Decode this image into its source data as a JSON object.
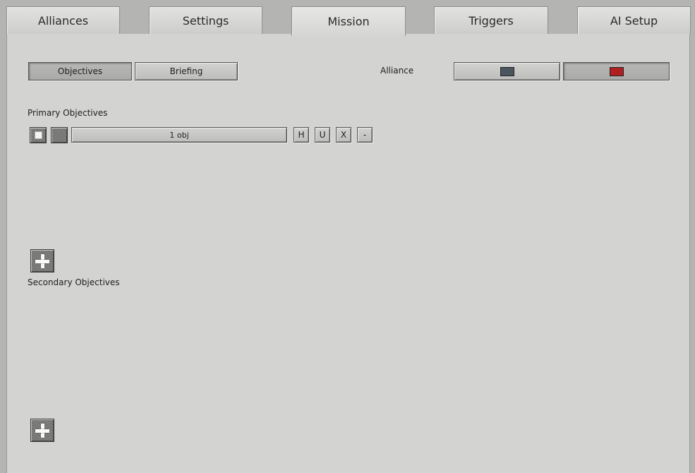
{
  "tabs": [
    {
      "label": "Alliances"
    },
    {
      "label": "Settings"
    },
    {
      "label": "Mission"
    },
    {
      "label": "Triggers"
    },
    {
      "label": "AI Setup"
    }
  ],
  "active_tab": "Mission",
  "mission": {
    "subtabs": {
      "objectives": "Objectives",
      "briefing": "Briefing"
    },
    "alliance_label": "Alliance",
    "alliance_colors": [
      "#4a5560",
      "#b02020"
    ],
    "primary_heading": "Primary Objectives",
    "objective": {
      "name": "1 obj",
      "buttons": [
        "H",
        "U",
        "X",
        "-"
      ]
    },
    "secondary_heading": "Secondary Objectives"
  },
  "icons": {
    "checkbox": "checkbox-icon",
    "texture": "texture-icon",
    "add": "plus-icon"
  }
}
